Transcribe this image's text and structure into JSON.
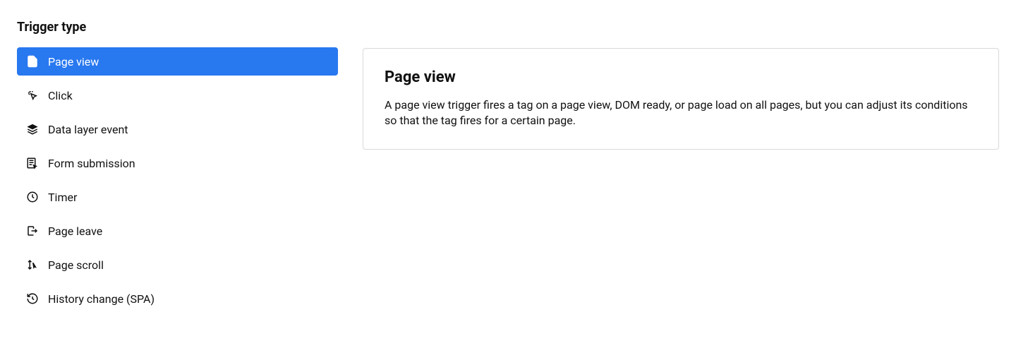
{
  "section": {
    "heading": "Trigger type"
  },
  "triggers": {
    "items": [
      {
        "label": "Page view"
      },
      {
        "label": "Click"
      },
      {
        "label": "Data layer event"
      },
      {
        "label": "Form submission"
      },
      {
        "label": "Timer"
      },
      {
        "label": "Page leave"
      },
      {
        "label": "Page scroll"
      },
      {
        "label": "History change (SPA)"
      }
    ],
    "selected_index": 0
  },
  "detail": {
    "title": "Page view",
    "description": "A page view trigger fires a tag on a page view, DOM ready, or page load on all pages, but you can adjust its conditions so that the tag fires for a certain page."
  }
}
